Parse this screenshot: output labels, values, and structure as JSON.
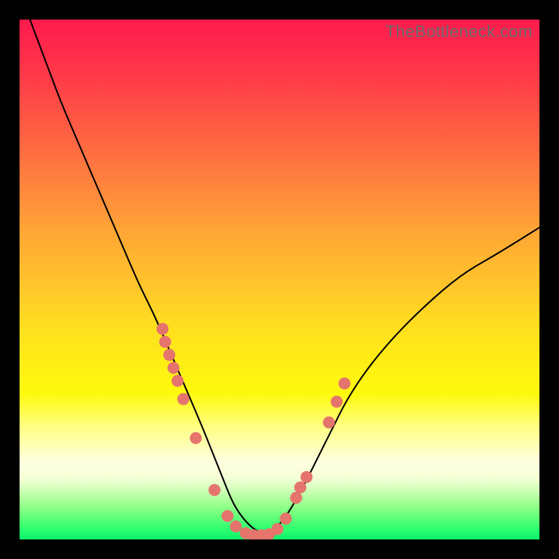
{
  "watermark": "TheBottleneck.com",
  "colors": {
    "curve": "#000000",
    "markers_fill": "#e5746c",
    "markers_stroke": "#c95d55"
  },
  "chart_data": {
    "type": "line",
    "title": "",
    "xlabel": "",
    "ylabel": "",
    "ylim": [
      0,
      100
    ],
    "xlim": [
      0,
      100
    ],
    "series": [
      {
        "name": "bottleneck-curve",
        "x": [
          2,
          5,
          8,
          11,
          14,
          17,
          20,
          23,
          26,
          29,
          32,
          35,
          37,
          39,
          41,
          43,
          45,
          47,
          49,
          51,
          54,
          57,
          60,
          63,
          67,
          72,
          78,
          85,
          92,
          100
        ],
        "y": [
          100,
          92,
          84,
          77,
          70,
          63,
          56,
          49,
          43,
          36,
          29,
          22,
          17,
          12,
          7,
          4,
          2,
          1,
          2,
          4,
          9,
          15,
          21,
          27,
          33,
          39,
          45,
          51,
          55,
          60
        ]
      }
    ],
    "markers": [
      {
        "x": 27.5,
        "y": 40.5
      },
      {
        "x": 28.0,
        "y": 38.0
      },
      {
        "x": 28.8,
        "y": 35.5
      },
      {
        "x": 29.6,
        "y": 33.0
      },
      {
        "x": 30.4,
        "y": 30.5
      },
      {
        "x": 31.5,
        "y": 27.0
      },
      {
        "x": 33.9,
        "y": 19.5
      },
      {
        "x": 37.5,
        "y": 9.5
      },
      {
        "x": 40.0,
        "y": 4.5
      },
      {
        "x": 41.6,
        "y": 2.5
      },
      {
        "x": 43.5,
        "y": 1.2
      },
      {
        "x": 45.0,
        "y": 0.8
      },
      {
        "x": 46.5,
        "y": 0.8
      },
      {
        "x": 48.0,
        "y": 1.0
      },
      {
        "x": 49.6,
        "y": 2.0
      },
      {
        "x": 51.2,
        "y": 4.0
      },
      {
        "x": 53.2,
        "y": 8.0
      },
      {
        "x": 54.0,
        "y": 10.0
      },
      {
        "x": 55.2,
        "y": 12.0
      },
      {
        "x": 59.5,
        "y": 22.5
      },
      {
        "x": 61.0,
        "y": 26.5
      },
      {
        "x": 62.5,
        "y": 30.0
      }
    ]
  }
}
